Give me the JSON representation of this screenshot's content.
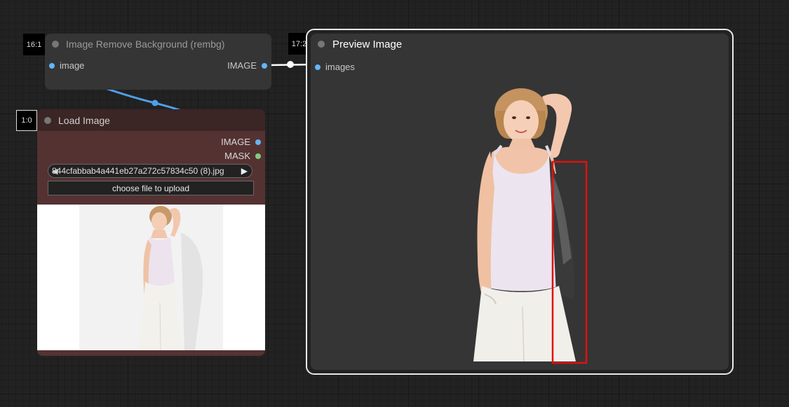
{
  "nodes": {
    "rembg": {
      "id": "16:1",
      "title": "Image Remove Background (rembg)",
      "input": "image",
      "output": "IMAGE"
    },
    "load_image": {
      "id": "1:0",
      "title": "Load Image",
      "outputs": [
        "IMAGE",
        "MASK"
      ],
      "file_value": "844cfabbab4a441eb27a272c57834c50 (8).jpg",
      "prev_arrow": "◀",
      "next_arrow": "▶",
      "upload_label": "choose file to upload"
    },
    "preview": {
      "id": "17:2",
      "title": "Preview Image",
      "input": "images"
    }
  },
  "colors": {
    "image_slot": "#64b5f6",
    "mask_slot": "#7dcf7d",
    "highlight_box": "#e01010",
    "link_blue": "#4f9fe8",
    "link_white": "#ffffff"
  }
}
